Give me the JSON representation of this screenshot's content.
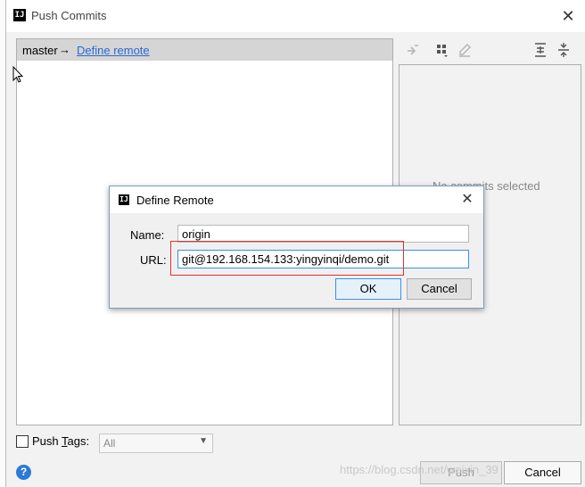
{
  "window": {
    "title": "Push Commits",
    "app_icon": "IJ",
    "close_glyph": "✕"
  },
  "repo": {
    "branch": "master",
    "arrow": "→",
    "define_remote_link": "Define remote"
  },
  "details": {
    "empty_text": "No commits selected"
  },
  "bottom": {
    "push_tags_label": "Push ",
    "push_tags_mnemonic": "T",
    "push_tags_rest": "ags:",
    "tags_select_value": "All",
    "push_button": "Push",
    "cancel_button": "Cancel",
    "help_glyph": "?",
    "watermark": "https://blog.csdn.net/weixin_39"
  },
  "dialog": {
    "title": "Define Remote",
    "app_icon": "IJ",
    "close_glyph": "✕",
    "name_label": "Name:",
    "name_value": "origin",
    "url_label": "URL:",
    "url_value": "git@192.168.154.133:yingyinqi/demo.git",
    "ok_button": "OK",
    "cancel_button": "Cancel"
  },
  "colors": {
    "link": "#2a6ad6",
    "focus_border": "#3d8ee6",
    "highlight_box": "#e03030"
  },
  "icons": [
    "arrow-icon",
    "group-icon",
    "edit-icon",
    "expand-all-icon",
    "collapse-all-icon",
    "help-icon",
    "cursor-icon"
  ]
}
